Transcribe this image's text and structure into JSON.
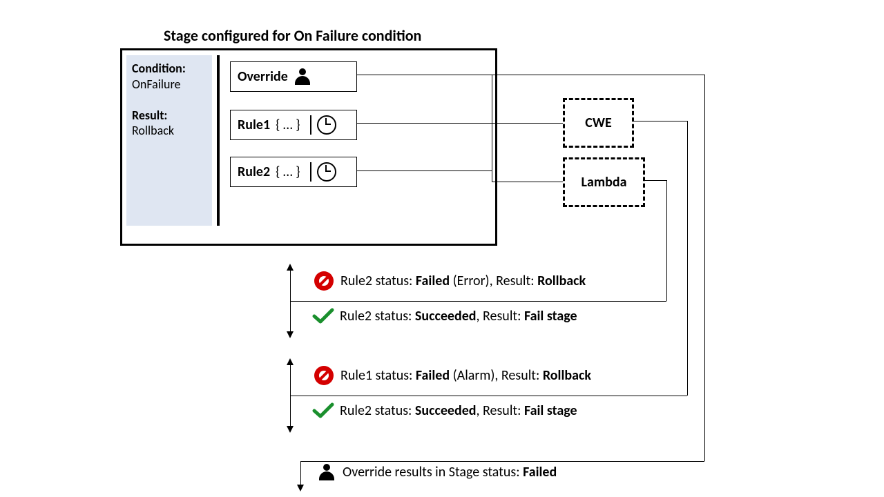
{
  "title": "Stage configured for On Failure condition",
  "sidebar": {
    "condition_label": "Condition:",
    "condition_value": "OnFailure",
    "result_label": "Result:",
    "result_value": "Rollback"
  },
  "boxes": {
    "override": "Override",
    "rule1": {
      "name": "Rule1",
      "body": "{ … }"
    },
    "rule2": {
      "name": "Rule2",
      "body": "{ … }"
    },
    "cwe": "CWE",
    "lambda": "Lambda"
  },
  "status": {
    "r2_fail_pre": "Rule2 status: ",
    "r2_fail_status": "Failed",
    "r2_fail_mid": " (Error), Result: ",
    "r2_fail_res": "Rollback",
    "r2_succ_pre": "Rule2 status: ",
    "r2_succ_status": "Succeeded",
    "r2_succ_mid": ", Result: ",
    "r2_succ_res": "Fail stage",
    "r1_fail_pre": "Rule1 status: ",
    "r1_fail_status": "Failed",
    "r1_fail_mid": " (Alarm), Result: ",
    "r1_fail_res": "Rollback",
    "r1_succ_pre": "Rule2 status: ",
    "r1_succ_status": "Succeeded",
    "r1_succ_mid": ", Result: ",
    "r1_succ_res": "Fail stage",
    "override_pre": "Override results in Stage status: ",
    "override_res": "Failed"
  }
}
